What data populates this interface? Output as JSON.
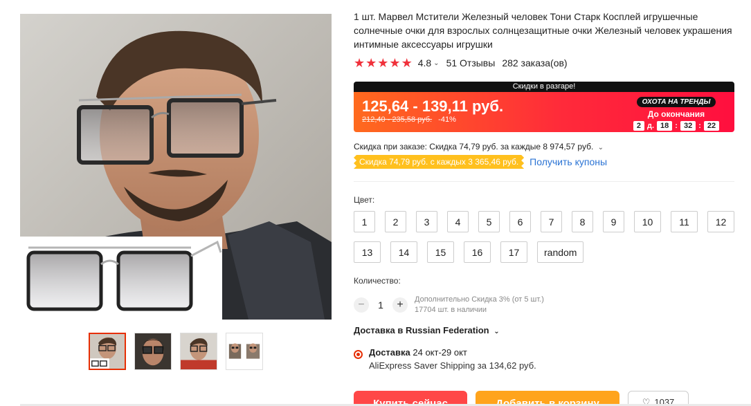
{
  "product": {
    "title": "1 шт. Марвел Мстители Железный человек Тони Старк Косплей игрушечные солнечные очки для взрослых солнцезащитные очки Железный человек украшения интимные аксессуары игрушки",
    "rating": "4.8",
    "reviews": "51 Отзывы",
    "orders": "282 заказа(ов)",
    "stars_filled": 5
  },
  "price": {
    "banner": "Скидки в разгаре!",
    "current": "125,64 - 139,11 руб.",
    "old": "212,40 - 235,58 руб.",
    "discount_pct": "-41%",
    "promo_badge": "ОХОТА НА ТРЕНДЫ",
    "promo_label": "До окончания",
    "countdown": {
      "days": "2",
      "days_unit": "д.",
      "hours": "18",
      "minutes": "32",
      "seconds": "22"
    }
  },
  "discounts": {
    "order_discount": "Скидка при заказе: Скидка 74,79 руб. за каждые 8 974,57 руб.",
    "coupon": "Скидка 74,79 руб. с каждых 3 365,46 руб.",
    "get_coupons": "Получить купоны"
  },
  "color": {
    "label": "Цвет:",
    "options": [
      "1",
      "2",
      "3",
      "4",
      "5",
      "6",
      "7",
      "8",
      "9",
      "10",
      "11",
      "12",
      "13",
      "14",
      "15",
      "16",
      "17",
      "random"
    ]
  },
  "quantity": {
    "label": "Количество:",
    "value": "1",
    "minus": "−",
    "plus": "+",
    "bulk_discount": "Дополнительно Скидка 3% (от 5 шт.)",
    "stock": "17704 шт. в наличии"
  },
  "shipping": {
    "ship_to": "Доставка в Russian Federation",
    "delivery_label": "Доставка",
    "delivery_dates": "24 окт-29 окт",
    "method": "AliExpress Saver Shipping за 134,62 руб."
  },
  "actions": {
    "buy": "Купить сейчас",
    "cart": "Добавить в корзину",
    "wish_count": "1037"
  },
  "colors": {
    "accent": "#e62e04",
    "star": "#f0313b",
    "link": "#2a73d4",
    "coupon": "#ffc01e",
    "buy": "#ff4747",
    "cart": "#ffa41c"
  }
}
